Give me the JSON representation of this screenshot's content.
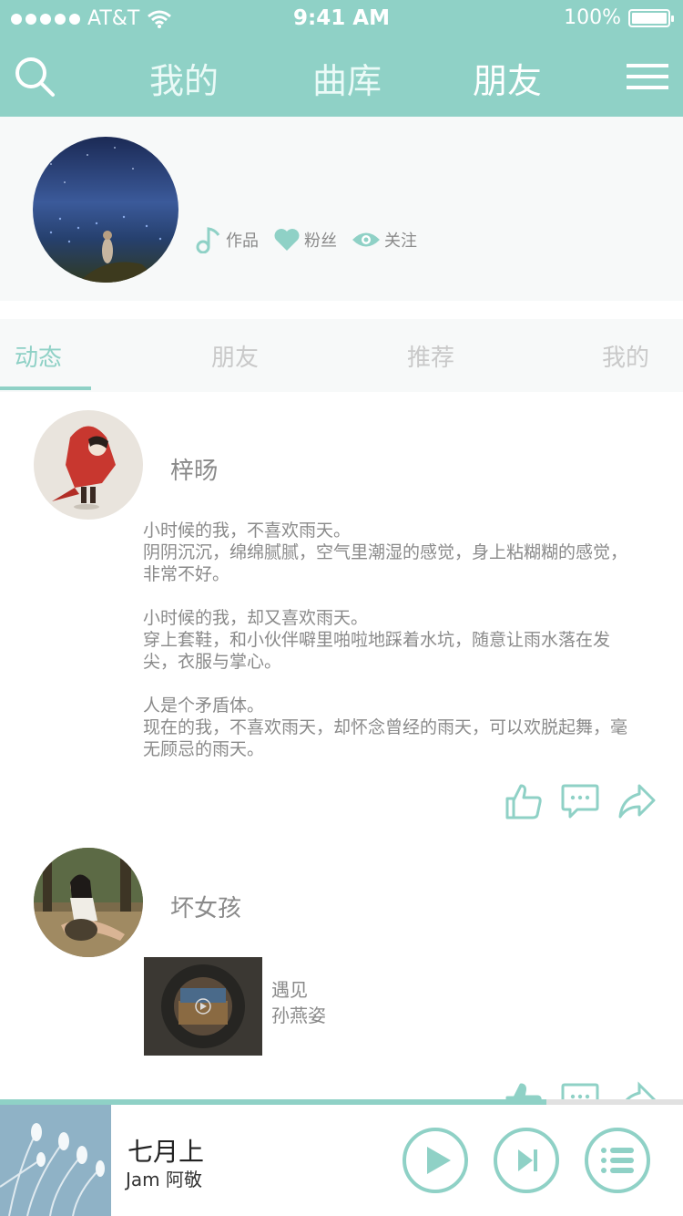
{
  "status_bar": {
    "carrier": "AT&T",
    "time": "9:41 AM",
    "battery": "100%"
  },
  "nav": {
    "tabs": [
      "我的",
      "曲库",
      "朋友"
    ],
    "active": "朋友"
  },
  "profile": {
    "stats": [
      "作品",
      "粉丝",
      "关注"
    ]
  },
  "sub_tabs": {
    "items": [
      "动态",
      "朋友",
      "推荐",
      "我的"
    ],
    "active": "动态"
  },
  "feed": [
    {
      "user": "梓旸",
      "paragraphs": [
        "小时候的我，不喜欢雨天。\n阴阴沉沉，绵绵腻腻，空气里潮湿的感觉，身上粘糊糊的感觉，非常不好。",
        "小时候的我，却又喜欢雨天。\n穿上套鞋，和小伙伴噼里啪啦地踩着水坑，随意让雨水落在发尖，衣服与掌心。",
        "人是个矛盾体。\n现在的我，不喜欢雨天，却怀念曾经的雨天，可以欢脱起舞，毫无顾忌的雨天。"
      ]
    },
    {
      "user": "坏女孩",
      "song": {
        "title": "遇见",
        "artist": "孙燕姿"
      }
    }
  ],
  "player": {
    "title": "七月上",
    "artist": "Jam 阿敬",
    "progress": 0.8
  },
  "colors": {
    "accent": "#8fd1c6",
    "text_gray": "#8a8a8a",
    "tab_inactive": "#c9c9c9"
  }
}
